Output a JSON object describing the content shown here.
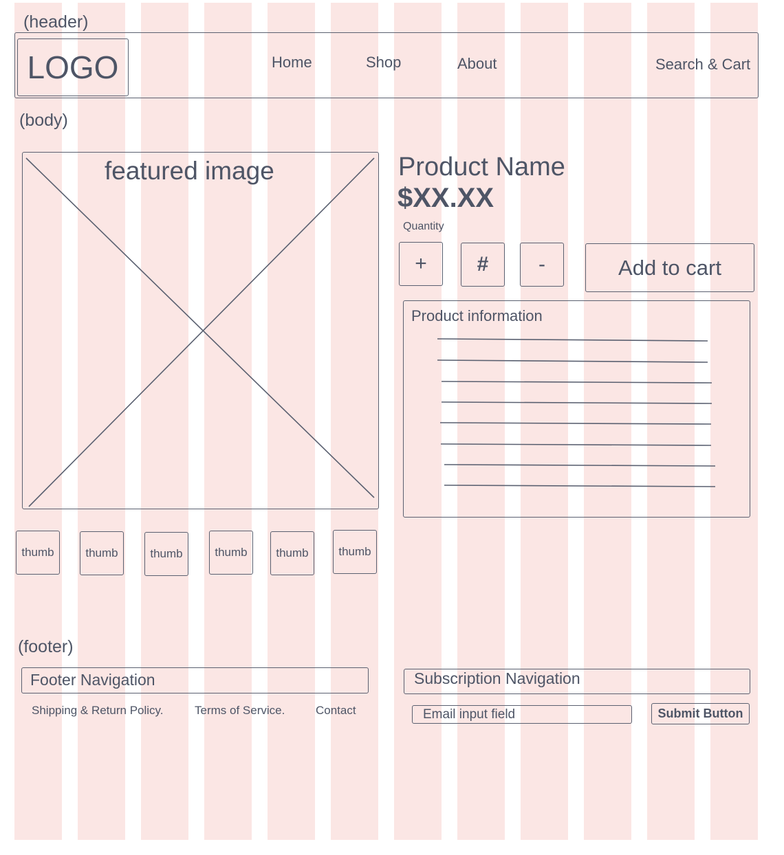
{
  "header": {
    "section_label": "(header)",
    "logo": "LOGO",
    "nav": [
      "Home",
      "Shop",
      "About"
    ],
    "search_cart": "Search & Cart"
  },
  "body": {
    "section_label": "(body)",
    "featured_image_label": "featured image",
    "thumbs": [
      "thumb",
      "thumb",
      "thumb",
      "thumb",
      "thumb",
      "thumb"
    ],
    "product_name": "Product Name",
    "price": "$XX.XX",
    "quantity_label": "Quantity",
    "quantity_plus": "+",
    "quantity_value": "#",
    "quantity_minus": "-",
    "add_to_cart": "Add to cart",
    "product_info_title": "Product information"
  },
  "footer": {
    "section_label": "(footer)",
    "footer_nav_title": "Footer Navigation",
    "links": [
      "Shipping & Return Policy.",
      "Terms of Service.",
      "Contact"
    ],
    "subscription_title": "Subscription Navigation",
    "email_placeholder": "Email input field",
    "submit": "Submit Button"
  },
  "colors": {
    "grid_column": "#fbe6e4",
    "ink": "#4e5566"
  }
}
